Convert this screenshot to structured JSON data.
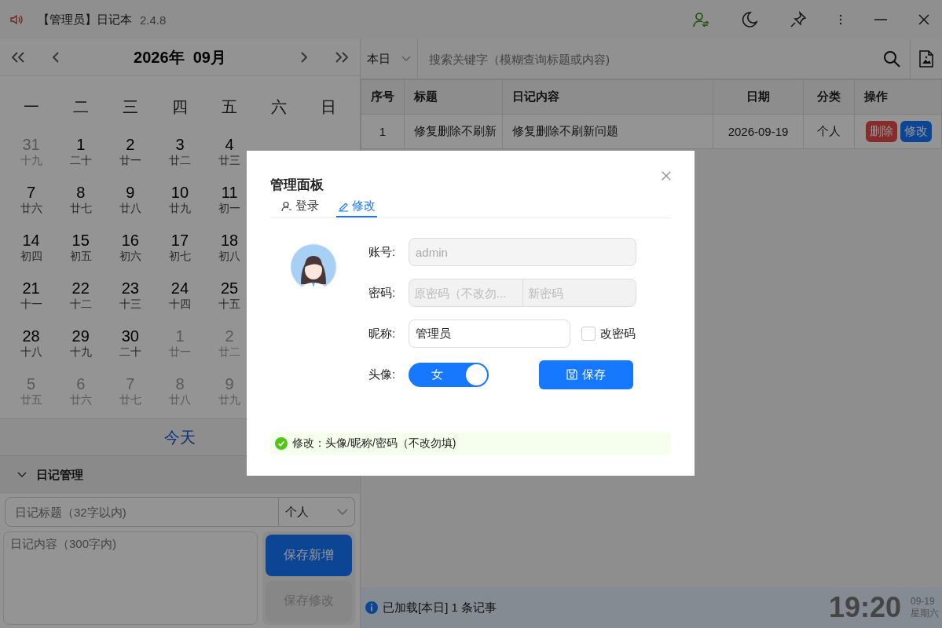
{
  "window": {
    "title": "【管理员】日记本",
    "version": "2.4.8"
  },
  "calendar": {
    "title": "2026年  09月",
    "weekdays": [
      "一",
      "二",
      "三",
      "四",
      "五",
      "六",
      "日"
    ],
    "weeks": [
      {
        "days": [
          {
            "day": "31",
            "lunar": "十九",
            "muted": true
          },
          {
            "day": "1",
            "lunar": "二十",
            "muted": false
          },
          {
            "day": "2",
            "lunar": "廿一",
            "muted": false
          },
          {
            "day": "3",
            "lunar": "廿二",
            "muted": false
          },
          {
            "day": "4",
            "lunar": "廿三",
            "muted": false
          }
        ]
      },
      {
        "days": [
          {
            "day": "7",
            "lunar": "廿六",
            "muted": false
          },
          {
            "day": "8",
            "lunar": "廿七",
            "muted": false
          },
          {
            "day": "9",
            "lunar": "廿八",
            "muted": false
          },
          {
            "day": "10",
            "lunar": "廿九",
            "muted": false
          },
          {
            "day": "11",
            "lunar": "初一",
            "muted": false
          }
        ]
      },
      {
        "days": [
          {
            "day": "14",
            "lunar": "初四",
            "muted": false
          },
          {
            "day": "15",
            "lunar": "初五",
            "muted": false
          },
          {
            "day": "16",
            "lunar": "初六",
            "muted": false
          },
          {
            "day": "17",
            "lunar": "初七",
            "muted": false
          },
          {
            "day": "18",
            "lunar": "初八",
            "muted": false
          }
        ]
      },
      {
        "days": [
          {
            "day": "21",
            "lunar": "十一",
            "muted": false
          },
          {
            "day": "22",
            "lunar": "十二",
            "muted": false
          },
          {
            "day": "23",
            "lunar": "十三",
            "muted": false
          },
          {
            "day": "24",
            "lunar": "十四",
            "muted": false
          },
          {
            "day": "25",
            "lunar": "十五",
            "muted": false
          }
        ]
      },
      {
        "days": [
          {
            "day": "28",
            "lunar": "十八",
            "muted": false
          },
          {
            "day": "29",
            "lunar": "十九",
            "muted": false
          },
          {
            "day": "30",
            "lunar": "二十",
            "muted": false
          },
          {
            "day": "1",
            "lunar": "廿一",
            "muted": true
          },
          {
            "day": "2",
            "lunar": "廿二",
            "muted": true
          }
        ]
      },
      {
        "days": [
          {
            "day": "5",
            "lunar": "廿五",
            "muted": true
          },
          {
            "day": "6",
            "lunar": "廿六",
            "muted": true
          },
          {
            "day": "7",
            "lunar": "廿七",
            "muted": true
          },
          {
            "day": "8",
            "lunar": "廿八",
            "muted": true
          },
          {
            "day": "9",
            "lunar": "廿九",
            "muted": true
          }
        ]
      }
    ],
    "today_button": "今天"
  },
  "diary_panel": {
    "title": "日记管理",
    "title_placeholder": "日记标题（32字以内)",
    "category": "个人",
    "content_placeholder": "日记内容（300字内)",
    "buttons": [
      {
        "label": "保存新增",
        "disabled": false
      },
      {
        "label": "保存修改",
        "disabled": true
      }
    ]
  },
  "search": {
    "range": "本日",
    "placeholder": "搜索关键字（模糊查询标题或内容)"
  },
  "table": {
    "columns": [
      "序号",
      "标题",
      "日记内容",
      "日期",
      "分类",
      "操作"
    ],
    "rows": [
      {
        "index": "1",
        "title": "修复删除不刷新",
        "content": "修复删除不刷新问题",
        "date": "2026-09-19",
        "category": "个人",
        "actions": [
          {
            "label": "删除",
            "kind": "danger"
          },
          {
            "label": "修改",
            "kind": "primary"
          }
        ]
      }
    ]
  },
  "status_bar": {
    "message": "已加载[本日] 1 条记事",
    "time": "19:20",
    "date": "09-19",
    "weekday": "星期六"
  },
  "dialog": {
    "title": "管理面板",
    "tabs": [
      {
        "label": "登录",
        "selected": false
      },
      {
        "label": "修改",
        "selected": true
      }
    ],
    "account": {
      "label": "账号:",
      "value": "admin",
      "disabled": true
    },
    "password": {
      "label": "密码:",
      "old_placeholder": "原密码（不改勿...",
      "new_placeholder": "新密码",
      "disabled": true
    },
    "nickname": {
      "label": "昵称:",
      "value": "管理员"
    },
    "change_password": {
      "label": "改密码",
      "checked": false
    },
    "avatar": {
      "label": "头像:",
      "option": "女",
      "on": true
    },
    "save_button": "保存",
    "hint": "修改：头像/昵称/密码（不改勿填)"
  }
}
